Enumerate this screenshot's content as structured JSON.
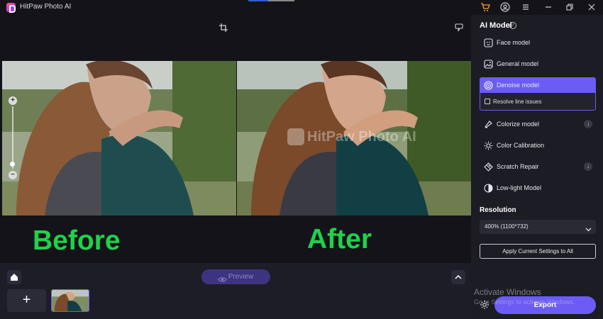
{
  "app": {
    "title": "HitPaw Photo AI"
  },
  "titlebar": {
    "icons": [
      "cart-icon",
      "account-icon",
      "menu-icon",
      "minimize-icon",
      "maximize-icon",
      "close-icon"
    ],
    "accent": "#f6a623"
  },
  "canvas": {
    "label_before": "Before",
    "label_after": "After",
    "label_color": "#1ed24a",
    "watermark": "HitPaw Photo AI"
  },
  "bottom": {
    "preview_label": "Preview",
    "add_label": "+"
  },
  "panel": {
    "title": "AI Model",
    "models": [
      {
        "label": "Face model",
        "icon": "face-icon"
      },
      {
        "label": "General model",
        "icon": "image-icon"
      },
      {
        "label": "Denoise model",
        "icon": "denoise-icon",
        "selected": true
      },
      {
        "label": "Colorize model",
        "icon": "colorize-icon",
        "expandable": true
      },
      {
        "label": "Color Calibration",
        "icon": "sun-icon"
      },
      {
        "label": "Scratch Repair",
        "icon": "scratch-icon",
        "expandable": true
      },
      {
        "label": "Low-light Model",
        "icon": "halfmoon-icon"
      }
    ],
    "option": {
      "label": "Resolve line issues",
      "checked": false
    },
    "resolution_title": "Resolution",
    "resolution_value": "400% (1100*732)",
    "apply_label": "Apply Current Settings to All",
    "export_label": "Export",
    "accent": "#6b5cf6"
  },
  "os_overlay": {
    "line1": "Activate Windows",
    "line2": "Go to Settings to activate Windows."
  }
}
